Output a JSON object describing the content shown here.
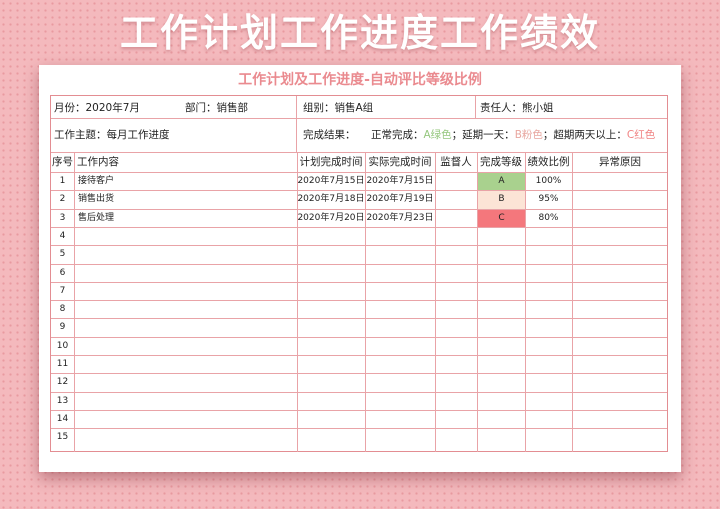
{
  "banner": "工作计划工作进度工作绩效",
  "sheet_title": "工作计划及工作进度-自动评比等级比例",
  "info": {
    "month": "月份：2020年7月",
    "dept": "部门：销售部",
    "group": "组别：销售A组",
    "owner": "责任人：熊小姐",
    "theme": "工作主题：每月工作进度",
    "result_label": "完成结果：",
    "normal": "正常完成：",
    "normal_val": "A绿色",
    "sep1": "；延期一天：",
    "delay_val": "B粉色",
    "sep2": "；超期两天以上：",
    "over_val": "C红色"
  },
  "headers": [
    "序号",
    "工作内容",
    "计划完成时间",
    "实际完成时间",
    "监督人",
    "完成等级",
    "绩效比例",
    "异常原因"
  ],
  "rows": [
    {
      "no": "1",
      "content": "接待客户",
      "plan": "2020年7月15日",
      "actual": "2020年7月15日",
      "level": "A",
      "ratio": "100%"
    },
    {
      "no": "2",
      "content": "销售出货",
      "plan": "2020年7月18日",
      "actual": "2020年7月19日",
      "level": "B",
      "ratio": "95%"
    },
    {
      "no": "3",
      "content": "售后处理",
      "plan": "2020年7月20日",
      "actual": "2020年7月23日",
      "level": "C",
      "ratio": "80%"
    }
  ],
  "empty_rows": [
    "4",
    "5",
    "6",
    "7",
    "8",
    "9",
    "10",
    "11",
    "12",
    "13",
    "14",
    "15"
  ],
  "colors": {
    "A": "#a9d18e",
    "B": "#fce4d6",
    "C": "#f4777c"
  }
}
